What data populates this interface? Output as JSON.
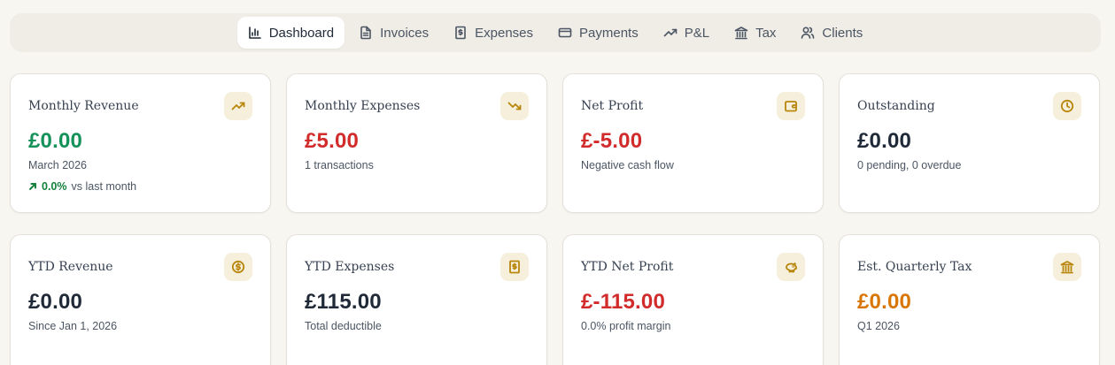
{
  "nav": {
    "tabs": [
      {
        "label": "Dashboard",
        "icon": "bar-chart-icon",
        "active": true
      },
      {
        "label": "Invoices",
        "icon": "file-text-icon",
        "active": false
      },
      {
        "label": "Expenses",
        "icon": "receipt-icon",
        "active": false
      },
      {
        "label": "Payments",
        "icon": "credit-card-icon",
        "active": false
      },
      {
        "label": "P&L",
        "icon": "trending-up-icon",
        "active": false
      },
      {
        "label": "Tax",
        "icon": "bank-icon",
        "active": false
      },
      {
        "label": "Clients",
        "icon": "users-icon",
        "active": false
      }
    ]
  },
  "cards": {
    "monthly_revenue": {
      "title": "Monthly Revenue",
      "value": "£0.00",
      "sub": "March 2026",
      "trend_pct": "0.0%",
      "trend_text": "vs last month",
      "icon": "trending-up-icon",
      "value_color": "#15915a"
    },
    "monthly_expenses": {
      "title": "Monthly Expenses",
      "value": "£5.00",
      "sub": "1 transactions",
      "icon": "trending-down-icon",
      "value_color": "#d12b2b"
    },
    "net_profit": {
      "title": "Net Profit",
      "value": "£-5.00",
      "sub": "Negative cash flow",
      "icon": "wallet-icon",
      "value_color": "#d12b2b"
    },
    "outstanding": {
      "title": "Outstanding",
      "value": "£0.00",
      "sub": "0 pending, 0 overdue",
      "icon": "clock-icon",
      "value_color": "#1f2937"
    },
    "ytd_revenue": {
      "title": "YTD Revenue",
      "value": "£0.00",
      "sub": "Since Jan 1, 2026",
      "icon": "dollar-circle-icon",
      "value_color": "#1f2937"
    },
    "ytd_expenses": {
      "title": "YTD Expenses",
      "value": "£115.00",
      "sub": "Total deductible",
      "icon": "receipt-icon",
      "value_color": "#1f2937"
    },
    "ytd_net_profit": {
      "title": "YTD Net Profit",
      "value": "£-115.00",
      "sub": "0.0% profit margin",
      "icon": "piggy-bank-icon",
      "value_color": "#d12b2b"
    },
    "est_quarterly_tax": {
      "title": "Est. Quarterly Tax",
      "value": "£0.00",
      "sub": "Q1 2026",
      "icon": "bank-icon",
      "value_color": "#d97706"
    }
  }
}
